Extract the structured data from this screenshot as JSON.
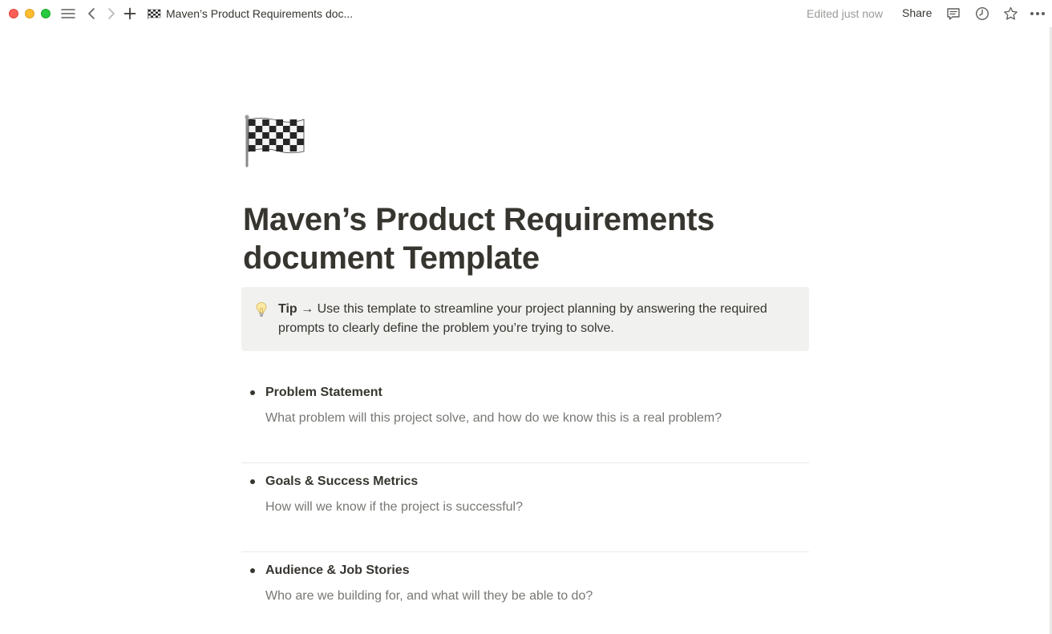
{
  "topbar": {
    "page_title": "Maven’s Product Requirements doc...",
    "edited": "Edited just now",
    "share_label": "Share"
  },
  "icons": {
    "page_icon": "chequered-flag-icon",
    "callout_icon": "lightbulb-icon"
  },
  "page": {
    "title_line1": "Maven’s Product Requirements",
    "title_line2": "document Template",
    "callout": {
      "tip_label": "Tip →",
      "text_line1": "Use this template to streamline your project planning by answering the required",
      "text_line2": "prompts to clearly define the problem you’re trying to solve."
    },
    "sections": [
      {
        "heading": "Problem Statement",
        "prompt": "What problem will this project solve, and how do we know this is a real problem?"
      },
      {
        "heading": "Goals & Success Metrics",
        "prompt": "How will we know if the project is successful?"
      },
      {
        "heading": "Audience & Job Stories",
        "prompt": "Who are we building for, and what will they be able to do?"
      }
    ]
  },
  "colors": {
    "text": "#37352f",
    "muted": "#787774",
    "callout_bg": "#f1f1ef",
    "divider": "#e9e9e7"
  }
}
